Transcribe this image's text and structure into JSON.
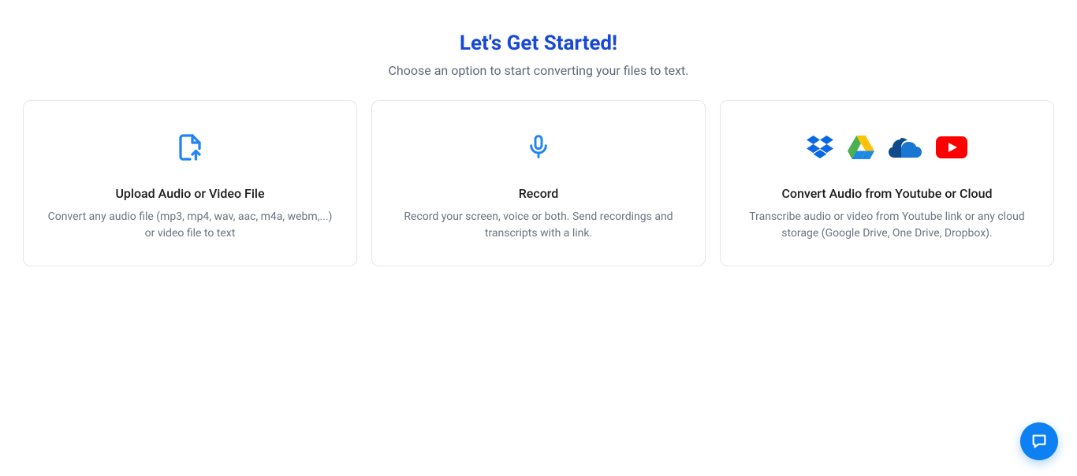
{
  "header": {
    "title": "Let's Get Started!",
    "subtitle": "Choose an option to start converting your files to text."
  },
  "cards": {
    "upload": {
      "title": "Upload Audio or Video File",
      "desc": "Convert any audio file (mp3, mp4, wav, aac, m4a, webm,...) or video file to text"
    },
    "record": {
      "title": "Record",
      "desc": "Record your screen, voice or both. Send recordings and transcripts with a link."
    },
    "cloud": {
      "title": "Convert Audio from Youtube or Cloud",
      "desc": "Transcribe audio or video from Youtube link or any cloud storage (Google Drive, One Drive, Dropbox)."
    }
  }
}
